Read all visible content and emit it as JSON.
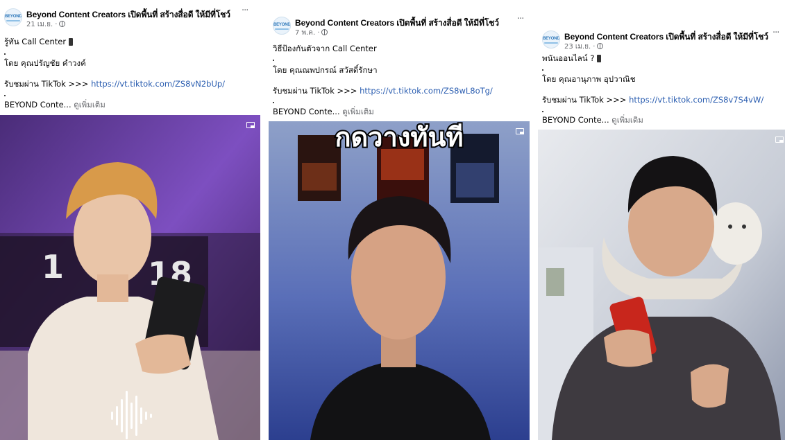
{
  "posts": [
    {
      "page_name": "Beyond Content Creators  เปิดพื้นที่ สร้างสื่อดี ให้มีที่โชว์",
      "date": "21 เม.ย. ·",
      "title": "รู้ทัน Call Center",
      "author": "โดย คุณปรัญชัย คำวงค์",
      "watch_prefix": "รับชมผ่าน TikTok >>> ",
      "link": "https://vt.tiktok.com/ZS8vN2bUp/",
      "preview": "BEYOND Conte...",
      "see_more": "ดูเพิ่มเติม",
      "video_overlay": "18"
    },
    {
      "page_name": "Beyond Content Creators  เปิดพื้นที่ สร้างสื่อดี ให้มีที่โชว์",
      "date": "7 พ.ค. ·",
      "title": "วิธีป้องกันตัวจาก Call Center",
      "author": "โดย คุณณพปกรณ์ สวัสดิ์รักษา",
      "watch_prefix": "รับชมผ่าน TikTok >>> ",
      "link": "https://vt.tiktok.com/ZS8wL8oTg/",
      "preview": "BEYOND Conte...",
      "see_more": "ดูเพิ่มเติม",
      "video_overlay": "กดวางทันที"
    },
    {
      "page_name": "Beyond Content Creators  เปิดพื้นที่ สร้างสื่อดี ให้มีที่โชว์",
      "date": "23 เม.ย. ·",
      "title": "พนันออนไลน์ ?",
      "author": "โดย คุณอานุภาพ อุปวาณิช",
      "watch_prefix": "รับชมผ่าน TikTok >>> ",
      "link": "https://vt.tiktok.com/ZS8v7S4vW/",
      "preview": "BEYOND Conte...",
      "see_more": "ดูเพิ่มเติม",
      "video_overlay": ""
    }
  ],
  "logo_text": "BEYOND",
  "more_label": "···",
  "colors": {
    "link": "#2a5db0",
    "meta": "#65676b",
    "video1_bg": "#6b3fa0",
    "video2_bg": "#2c3f8f",
    "video3_bg": "#cfd4dc"
  }
}
